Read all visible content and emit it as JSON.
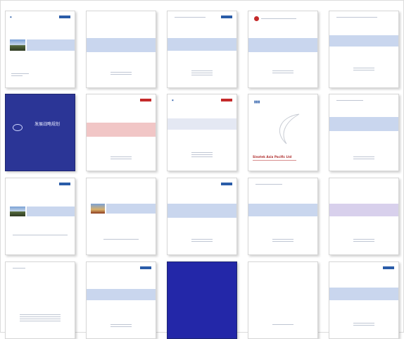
{
  "rows": [
    [
      {
        "band": "",
        "footer": ""
      },
      {
        "band": "",
        "footer": ""
      },
      {
        "band": "",
        "footer": ""
      },
      {
        "band": "",
        "footer": ""
      },
      {
        "band": "",
        "footer": ""
      }
    ],
    [
      {
        "title": "发展战略规划",
        "footer": ""
      },
      {
        "band": "",
        "footer": ""
      },
      {
        "band": "",
        "footer": ""
      },
      {
        "title": "Sinotek Asia Pacific Ltd",
        "footer": ""
      },
      {
        "band": "",
        "footer": ""
      }
    ],
    [
      {
        "band": "",
        "footer": ""
      },
      {
        "band": "",
        "footer": ""
      },
      {
        "band": "",
        "footer": ""
      },
      {
        "band": "",
        "footer": ""
      },
      {
        "band": "",
        "footer": ""
      }
    ],
    [
      {
        "title": "",
        "footer": ""
      },
      {
        "band": "",
        "footer": ""
      },
      {
        "band": "",
        "footer": ""
      },
      {
        "title": "",
        "footer": ""
      },
      {
        "band": "",
        "footer": ""
      }
    ]
  ],
  "colors": {
    "band_blue": "#c9d6ee",
    "band_pink": "#f1c6c6",
    "band_lavender": "#d8d0ec",
    "dark_cover": "#2b3596"
  }
}
